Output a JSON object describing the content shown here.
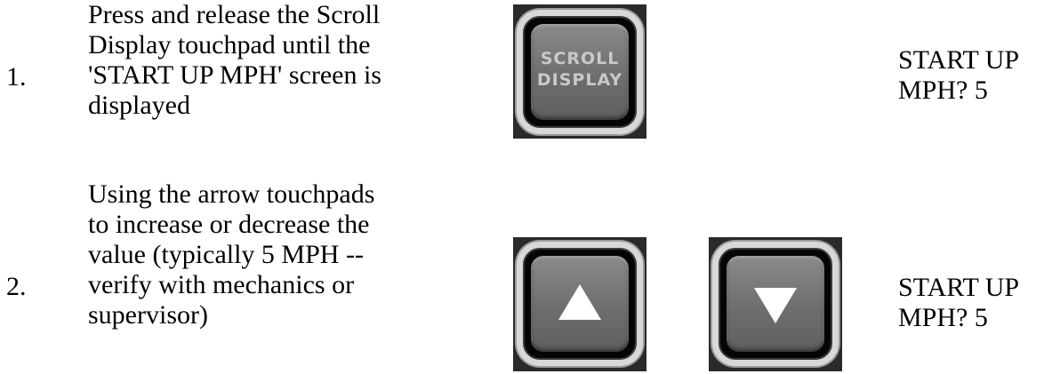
{
  "steps": [
    {
      "number": "1.",
      "text": "Press and release the Scroll\nDisplay touchpad until the\n'START UP MPH' screen is\ndisplayed",
      "result": "START UP\nMPH? 5",
      "buttons": [
        {
          "icon": "scroll-display-key",
          "label_line1": "SCROLL",
          "label_line2": "DISPLAY"
        }
      ]
    },
    {
      "number": "2.",
      "text": "Using the arrow touchpads\nto increase or decrease the\nvalue (typically 5 MPH --\nverify with mechanics or\nsupervisor)",
      "result": "START UP\nMPH? 5",
      "buttons": [
        {
          "icon": "up-arrow-key"
        },
        {
          "icon": "down-arrow-key"
        }
      ]
    }
  ]
}
